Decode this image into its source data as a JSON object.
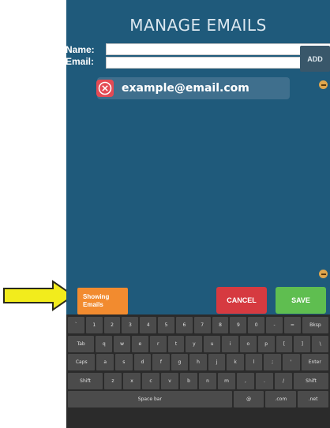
{
  "header": {
    "title": "MANAGE EMAILS"
  },
  "form": {
    "name_label": "Name:",
    "email_label": "Email:",
    "name_value": "",
    "email_value": "",
    "add_label": "ADD"
  },
  "emails": [
    {
      "address": "example@email.com"
    }
  ],
  "footer": {
    "showing_line1": "Showing",
    "showing_line2": "Emails",
    "cancel_label": "CANCEL",
    "save_label": "SAVE"
  },
  "keyboard": {
    "row1": [
      "`",
      "1",
      "2",
      "3",
      "4",
      "5",
      "6",
      "7",
      "8",
      "9",
      "0",
      "-",
      "=",
      "Bksp"
    ],
    "row2": [
      "Tab",
      "q",
      "w",
      "e",
      "r",
      "t",
      "y",
      "u",
      "i",
      "o",
      "p",
      "[",
      "]",
      "\\"
    ],
    "row3": [
      "Caps",
      "a",
      "s",
      "d",
      "f",
      "g",
      "h",
      "j",
      "k",
      "l",
      ";",
      "'",
      "Enter"
    ],
    "row4": [
      "Shift",
      "z",
      "x",
      "c",
      "v",
      "b",
      "n",
      "m",
      ",",
      ".",
      "/",
      "Shift"
    ],
    "row5": [
      "Space bar",
      "@",
      ".com",
      ".net"
    ]
  },
  "colors": {
    "panel": "#1f5a7b",
    "accent_orange": "#f28b2f",
    "cancel": "#d63a40",
    "save": "#5fbe50",
    "arrow": "#f2ec1c"
  }
}
